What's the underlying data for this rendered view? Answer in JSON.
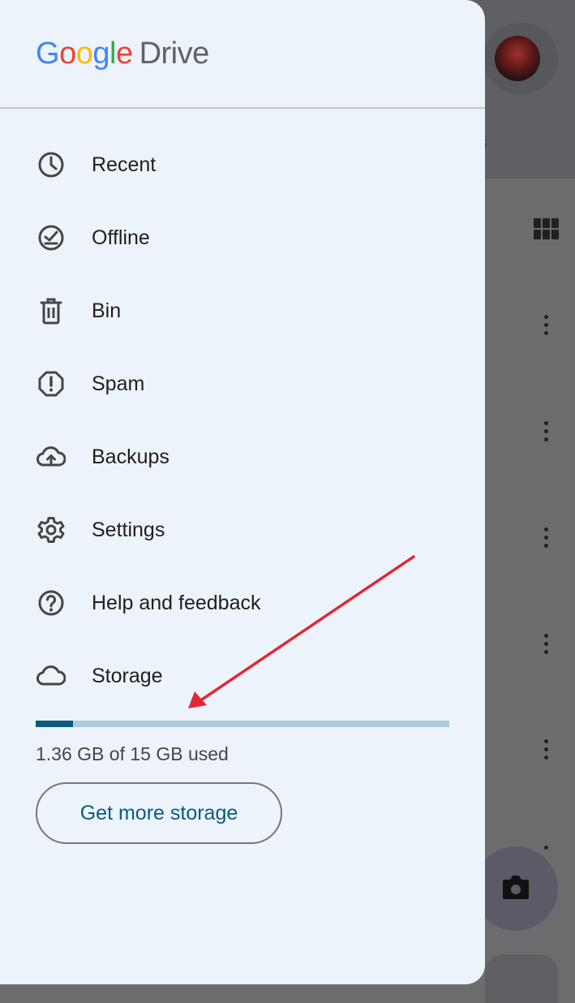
{
  "app": {
    "logo_text": "Google",
    "logo_product": "Drive"
  },
  "menu": {
    "items": [
      {
        "label": "Recent",
        "icon": "clock-icon"
      },
      {
        "label": "Offline",
        "icon": "offline-icon"
      },
      {
        "label": "Bin",
        "icon": "trash-icon"
      },
      {
        "label": "Spam",
        "icon": "spam-icon"
      },
      {
        "label": "Backups",
        "icon": "cloud-upload-icon"
      },
      {
        "label": "Settings",
        "icon": "gear-icon"
      },
      {
        "label": "Help and feedback",
        "icon": "help-icon"
      },
      {
        "label": "Storage",
        "icon": "cloud-icon"
      }
    ]
  },
  "storage": {
    "used_text": "1.36 GB of 15 GB used",
    "used_fraction": 0.091,
    "button_label": "Get more storage"
  },
  "colors": {
    "accent": "#0b5b80",
    "track": "#a9cbdb",
    "drawer_bg": "#edf3fb",
    "annotation_arrow": "#e32636"
  }
}
